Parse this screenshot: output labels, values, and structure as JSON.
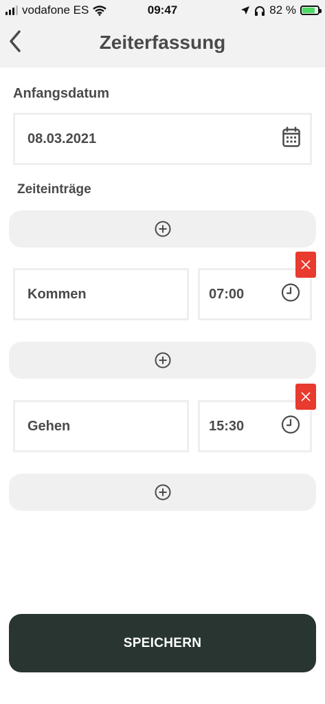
{
  "status_bar": {
    "carrier": "vodafone ES",
    "time": "09:47",
    "battery_percent": "82 %",
    "battery_level": 0.82
  },
  "header": {
    "title": "Zeiterfassung",
    "back_icon": "chevron-left-icon"
  },
  "form": {
    "start_date_label": "Anfangsdatum",
    "start_date_value": "08.03.2021",
    "entries_label": "Zeiteinträge",
    "entries": [
      {
        "type": "Kommen",
        "time": "07:00"
      },
      {
        "type": "Gehen",
        "time": "15:30"
      }
    ],
    "icons": {
      "calendar": "calendar-icon",
      "clock": "clock-icon",
      "add": "plus-circle-icon",
      "remove": "close-icon"
    },
    "colors": {
      "remove_bg": "#e83a2e",
      "save_bg": "#283530"
    }
  },
  "actions": {
    "save_label": "SPEICHERN"
  }
}
